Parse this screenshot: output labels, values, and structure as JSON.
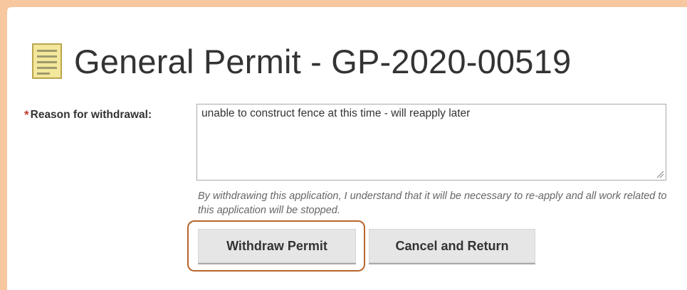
{
  "header": {
    "icon": "document-list-icon",
    "title": "General Permit - GP-2020-00519"
  },
  "form": {
    "required_marker": "*",
    "reason_label": "Reason for withdrawal:",
    "reason_value": "unable to construct fence at this time - will reapply later",
    "help_text": "By withdrawing this application, I understand that it will be necessary to re-apply and all work related to this application will be stopped."
  },
  "actions": {
    "withdraw_label": "Withdraw Permit",
    "cancel_label": "Cancel and Return"
  },
  "colors": {
    "page_border": "#f7c79f",
    "highlight": "#b8652c",
    "required": "#c0392b",
    "button_bg": "#e6e6e6"
  }
}
